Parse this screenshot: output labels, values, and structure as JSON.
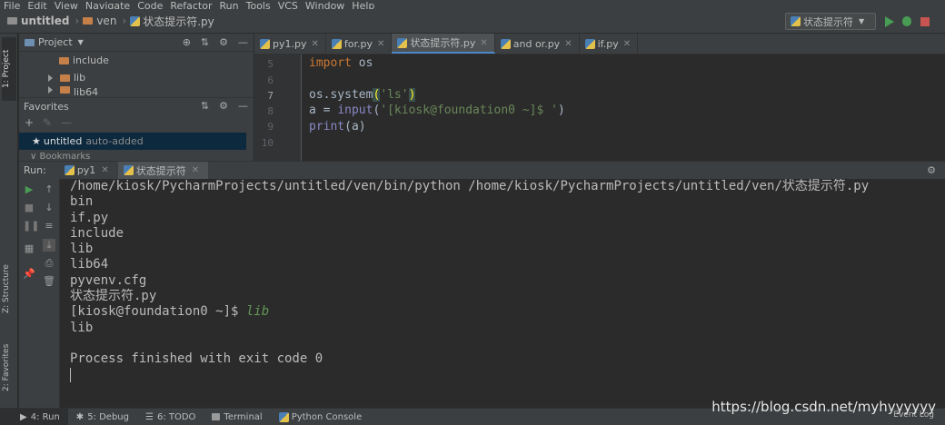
{
  "menu": [
    "File",
    "Edit",
    "View",
    "Navigate",
    "Code",
    "Refactor",
    "Run",
    "Tools",
    "VCS",
    "Window",
    "Help"
  ],
  "breadcrumb": {
    "project": "untitled",
    "folder": "ven",
    "file": "状态提示符.py"
  },
  "run_config": "状态提示符",
  "side_tabs": {
    "project": "1: Project",
    "structure": "Z: Structure",
    "favorites": "2: Favorites"
  },
  "project_panel": {
    "title": "Project",
    "tree": [
      {
        "label": "include",
        "expandable": false
      },
      {
        "label": "lib",
        "expandable": true
      },
      {
        "label": "lib64",
        "expandable": true
      }
    ],
    "favorites_title": "Favorites",
    "favorite_item": {
      "name": "untitled",
      "note": "auto-added"
    },
    "bookmarks": "Bookmarks"
  },
  "editor_tabs": [
    {
      "label": "py1.py",
      "active": false
    },
    {
      "label": "for.py",
      "active": false
    },
    {
      "label": "状态提示符.py",
      "active": true
    },
    {
      "label": "and or.py",
      "active": false
    },
    {
      "label": "if.py",
      "active": false
    }
  ],
  "code": {
    "line_numbers": [
      "5",
      "6",
      "7",
      "8",
      "9",
      "10"
    ],
    "current_line": "7"
  },
  "run_panel": {
    "label": "Run:",
    "tabs": [
      {
        "label": "py1",
        "active": false
      },
      {
        "label": "状态提示符",
        "active": true
      }
    ],
    "output": [
      "/home/kiosk/PycharmProjects/untitled/ven/bin/python /home/kiosk/PycharmProjects/untitled/ven/状态提示符.py",
      "bin",
      "if.py",
      "include",
      "lib",
      "lib64",
      "pyvenv.cfg",
      "状态提示符.py"
    ],
    "prompt": "[kiosk@foundation0 ~]$ ",
    "user_input": "lib",
    "echo": "lib",
    "finish": "Process finished with exit code 0"
  },
  "status_bar": {
    "run": "4: Run",
    "debug": "5: Debug",
    "todo": "6: TODO",
    "terminal": "Terminal",
    "python_console": "Python Console",
    "event_log": "Event Log"
  },
  "watermark": "https://blog.csdn.net/myhyyyyyy",
  "colors": {
    "keyword": "#cc7832",
    "string": "#6a8759",
    "builtin": "#8888c6",
    "input": "#629755",
    "accent": "#4a88c7"
  }
}
